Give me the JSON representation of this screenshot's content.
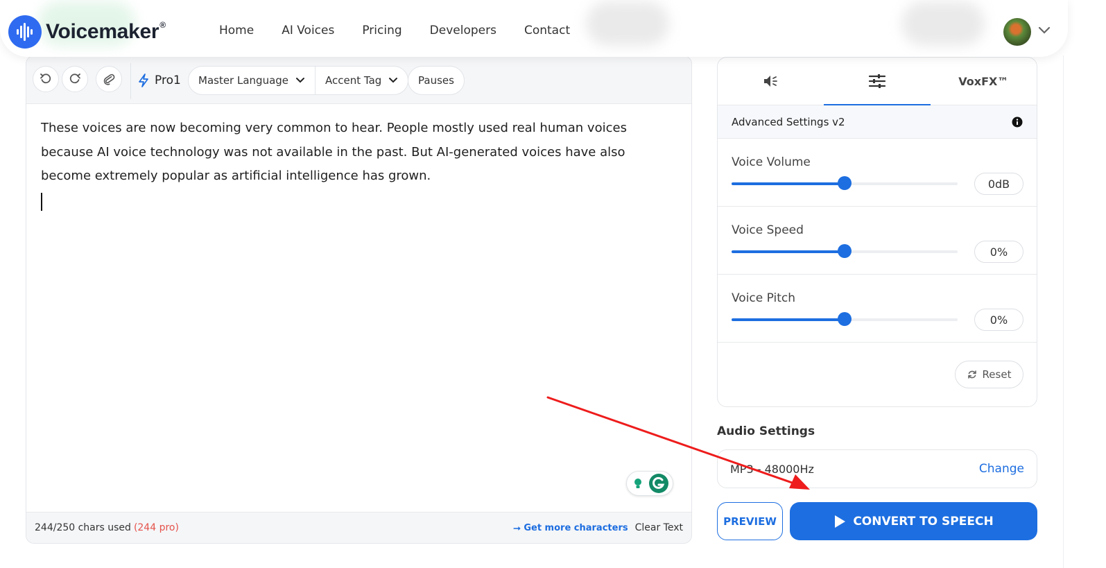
{
  "nav": {
    "brand": "Voicemaker",
    "brand_mark": "®",
    "links": [
      "Home",
      "AI Voices",
      "Pricing",
      "Developers",
      "Contact"
    ]
  },
  "editor": {
    "toolbar": {
      "undo_icon": "undo-icon",
      "redo_icon": "redo-icon",
      "attach_icon": "paperclip-icon",
      "pro_label": "Pro1",
      "master_language": "Master Language",
      "accent_tag": "Accent Tag",
      "pauses": "Pauses"
    },
    "text": "These voices are now becoming very common to hear. People mostly used real human voices because AI voice technology was not available in the past. But AI-generated voices have also become extremely popular as artificial intelligence has grown.",
    "footer": {
      "chars_used": "244/250 chars used",
      "chars_pro": "(244 pro)",
      "get_more": "⭢ Get more characters",
      "clear_text": "Clear Text"
    }
  },
  "settings_panel": {
    "tabs": [
      {
        "icon": "speaker-icon",
        "label": ""
      },
      {
        "icon": "sliders-icon",
        "label": ""
      },
      {
        "label": "VoxFX™"
      }
    ],
    "advanced_title": "Advanced Settings v2",
    "sliders": [
      {
        "label": "Voice Volume",
        "value": "0dB",
        "level": 0.5
      },
      {
        "label": "Voice Speed",
        "value": "0%",
        "level": 0.5
      },
      {
        "label": "Voice Pitch",
        "value": "0%",
        "level": 0.5
      }
    ],
    "reset_label": "Reset"
  },
  "audio": {
    "title": "Audio Settings",
    "format": "MP3 - 48000Hz",
    "change_label": "Change"
  },
  "actions": {
    "preview": "PREVIEW",
    "convert": "CONVERT TO SPEECH"
  },
  "colors": {
    "accent": "#1d6ee0",
    "pro_red": "#e5534b",
    "annotation_arrow": "#ee1c1c"
  }
}
